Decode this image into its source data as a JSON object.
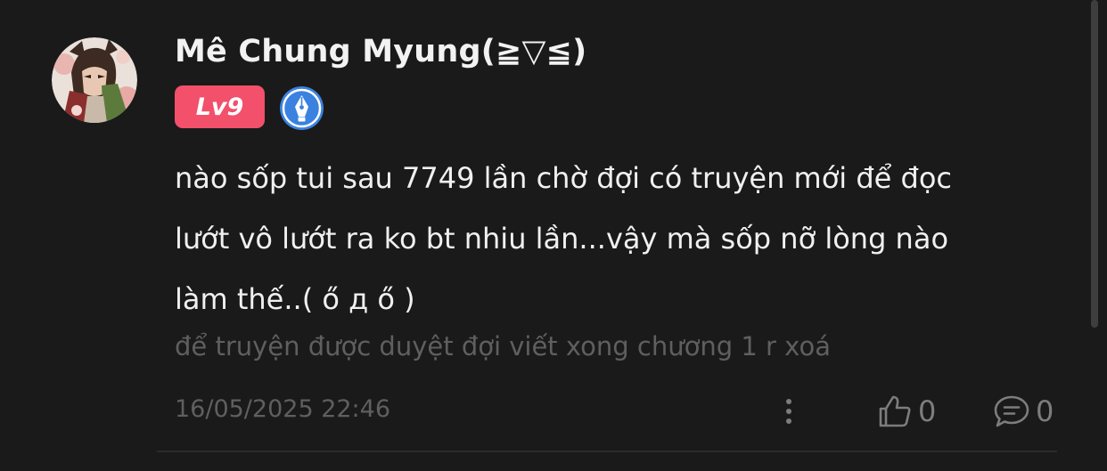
{
  "comment": {
    "author": "Mê Chung Myung(≧▽≦)",
    "level_badge": "Lv9",
    "content_lines": [
      "nào sốp tui sau 7749 lần chờ đợi có truyện mới để đọc",
      "lướt vô lướt ra ko bt nhiu lần...vậy mà sốp nỡ lòng nào",
      "làm thế..( ő д ő )"
    ],
    "edit_note": "để truyện được duyệt đợi viết xong chương 1 r xoá",
    "timestamp": "16/05/2025 22:46",
    "like_count": "0",
    "reply_count": "0"
  },
  "icons": {
    "more": "more-vertical-icon",
    "like": "thumbs-up-icon",
    "reply": "chat-bubble-icon",
    "author_badge": "fountain-pen-icon"
  },
  "colors": {
    "background": "#1a1a1a",
    "level_badge": "#f2506b",
    "author_badge": "#3b82e0",
    "muted_text": "#5f5f5f"
  }
}
